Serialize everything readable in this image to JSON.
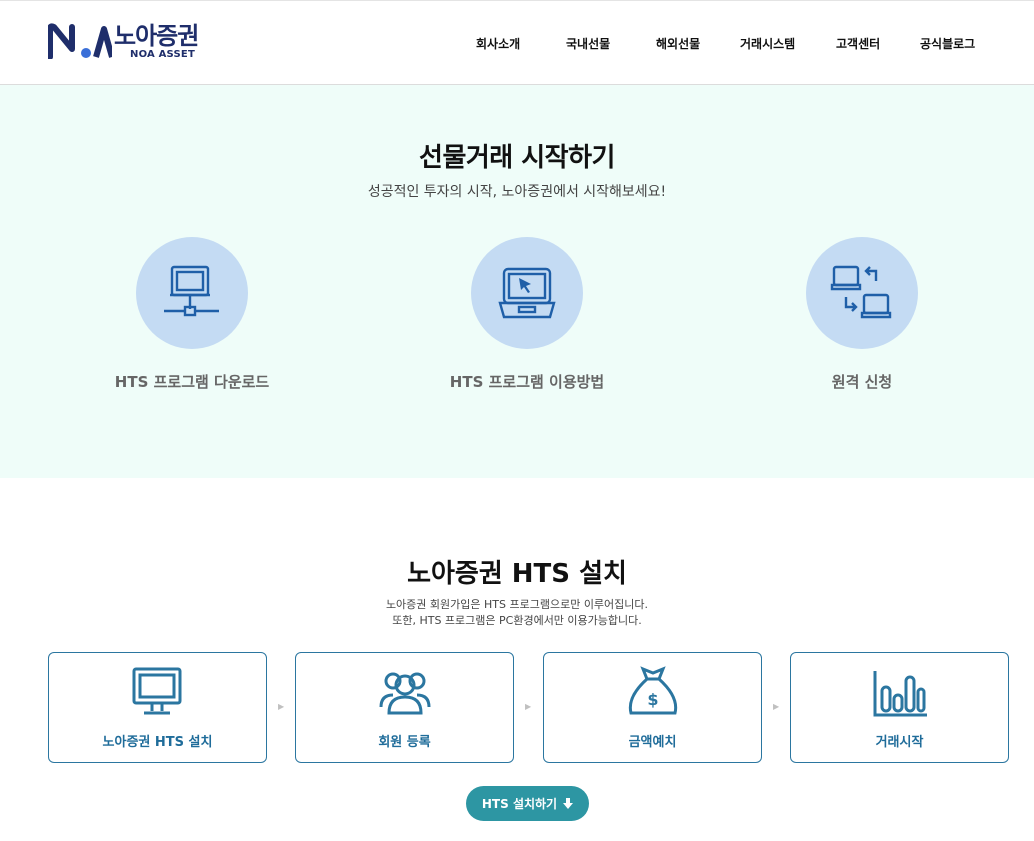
{
  "header": {
    "logo": {
      "ko": "노아증권",
      "en": "NOA ASSET",
      "mark_icon": "noa-logo-mark"
    },
    "nav": [
      "회사소개",
      "국내선물",
      "해외선물",
      "거래시스템",
      "고객센터",
      "공식블로그"
    ]
  },
  "hero": {
    "title": "선물거래 시작하기",
    "subtitle": "성공적인 투자의 시작, 노아증권에서 시작해보세요!",
    "services": [
      {
        "label": "HTS 프로그램 다운로드",
        "icon": "network-computer-icon"
      },
      {
        "label": "HTS 프로그램 이용방법",
        "icon": "laptop-cursor-icon"
      },
      {
        "label": "원격 신청",
        "icon": "remote-computers-icon"
      }
    ]
  },
  "install": {
    "title": "노아증권 HTS 설치",
    "desc_line1": "노아증권 회원가입은 HTS 프로그램으로만 이루어집니다.",
    "desc_line2": "또한, HTS 프로그램은 PC환경에서만 이용가능합니다.",
    "steps": [
      {
        "label": "노아증권 HTS 설치",
        "icon": "monitor-icon"
      },
      {
        "label": "회원 등록",
        "icon": "users-icon"
      },
      {
        "label": "금액예치",
        "icon": "money-bag-icon"
      },
      {
        "label": "거래시작",
        "icon": "bar-chart-icon"
      }
    ],
    "button_label": "HTS 설치하기",
    "button_icon": "download-arrow-icon"
  },
  "colors": {
    "brand_navy": "#1f2e6b",
    "hero_bg": "#effdf9",
    "circle_bg": "#c4dbf3",
    "step_blue": "#1f6c9a",
    "button_teal": "#2d96a3"
  }
}
